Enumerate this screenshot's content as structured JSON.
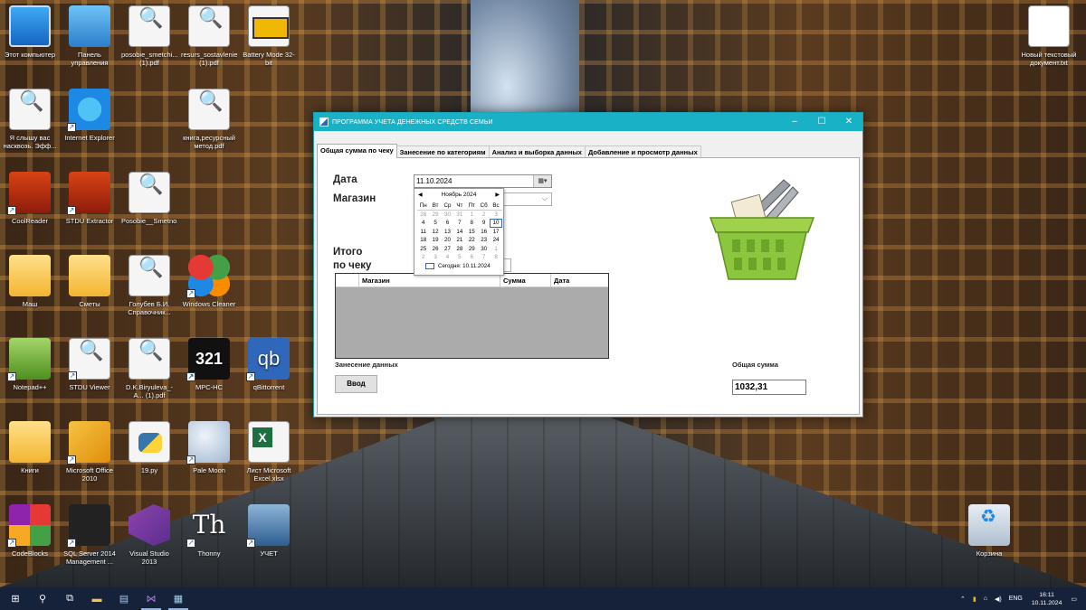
{
  "desktop": {
    "icons": [
      {
        "label": "Этот компьютер",
        "icon": "computer-icon"
      },
      {
        "label": "Панель управления",
        "icon": "control-panel-icon"
      },
      {
        "label": "posobie_smetchi... (1).pdf",
        "icon": "pdf-file-icon"
      },
      {
        "label": "resurs_sostavlenie (1).pdf",
        "icon": "pdf-file-icon"
      },
      {
        "label": "Battery Mode 32-bit",
        "icon": "battery-icon"
      },
      {
        "label": "Я слышу вас насквозь. Эфф...",
        "icon": "pdf-file-icon"
      },
      {
        "label": "Internet Explorer",
        "icon": "internet-explorer-icon"
      },
      {
        "label": "книга,ресурсный метод.pdf",
        "icon": "pdf-file-icon"
      },
      {
        "label": "CoolReader",
        "icon": "coolreader-icon"
      },
      {
        "label": "STDU Extractor",
        "icon": "stdu-extractor-icon"
      },
      {
        "label": "Posobie__Smetno...",
        "icon": "pdf-file-icon"
      },
      {
        "label": "Маш",
        "icon": "folder-icon"
      },
      {
        "label": "Сметы",
        "icon": "folder-icon"
      },
      {
        "label": "Голубев Б.И. Справочник...",
        "icon": "pdf-file-icon"
      },
      {
        "label": "Windows Cleaner",
        "icon": "windows-cleaner-icon"
      },
      {
        "label": "Notepad++",
        "icon": "notepad-plus-plus-icon"
      },
      {
        "label": "STDU Viewer",
        "icon": "stdu-viewer-icon"
      },
      {
        "label": "D.K.Biryuleva_-A... (1).pdf",
        "icon": "pdf-file-icon"
      },
      {
        "label": "MPC-HC",
        "icon": "mpc-hc-icon"
      },
      {
        "label": "qBittorrent",
        "icon": "qbittorrent-icon"
      },
      {
        "label": "Книги",
        "icon": "folder-icon"
      },
      {
        "label": "Microsoft Office 2010",
        "icon": "microsoft-office-icon"
      },
      {
        "label": "19.py",
        "icon": "python-file-icon"
      },
      {
        "label": "Pale Moon",
        "icon": "pale-moon-icon"
      },
      {
        "label": "Лист Microsoft Excel.xlsx",
        "icon": "excel-file-icon"
      },
      {
        "label": "CodeBlocks",
        "icon": "codeblocks-icon"
      },
      {
        "label": "SQL Server 2014 Management ...",
        "icon": "sql-server-icon"
      },
      {
        "label": "Visual Studio 2013",
        "icon": "visual-studio-icon"
      },
      {
        "label": "Thonny",
        "icon": "thonny-icon"
      },
      {
        "label": "УЧЕТ",
        "icon": "app-shortcut-icon"
      },
      {
        "label": "Новый текстовый документ.txt",
        "icon": "text-file-icon"
      },
      {
        "label": "Корзина",
        "icon": "recycle-bin-icon"
      }
    ]
  },
  "window": {
    "title": "ПРОГРАММА УЧЕТА ДЕНЕЖНЫХ СРЕДСТВ СЕМЬИ",
    "controls": {
      "minimize": "–",
      "maximize": "☐",
      "close": "✕"
    },
    "tabs": [
      {
        "label": "Общая сумма по чеку",
        "active": true
      },
      {
        "label": "Занесение по категориям",
        "active": false
      },
      {
        "label": "Анализ и выборка данных",
        "active": false
      },
      {
        "label": "Добавление и просмотр данных",
        "active": false
      }
    ],
    "form": {
      "date_label": "Дата",
      "date_value": "11.10.2024",
      "shop_label": "Магазин",
      "total_label_line1": "Итого",
      "total_label_line2": "по чеку",
      "entry_label": "Занесение данных",
      "enter_button": "Ввод",
      "sum_label": "Общая сумма",
      "sum_value": "1032,31"
    },
    "grid": {
      "columns": [
        "",
        "Магазин",
        "Сумма",
        "Дата"
      ]
    },
    "calendar": {
      "month": "Ноябрь 2024",
      "days_of_week": [
        "Пн",
        "Вт",
        "Ср",
        "Чт",
        "Пт",
        "Сб",
        "Вс"
      ],
      "weeks": [
        [
          {
            "d": "28",
            "o": true
          },
          {
            "d": "29",
            "o": true
          },
          {
            "d": "30",
            "o": true
          },
          {
            "d": "31",
            "o": true
          },
          {
            "d": "1",
            "o": true
          },
          {
            "d": "2",
            "o": true
          },
          {
            "d": "3",
            "o": true
          }
        ],
        [
          {
            "d": "4"
          },
          {
            "d": "5"
          },
          {
            "d": "6"
          },
          {
            "d": "7"
          },
          {
            "d": "8"
          },
          {
            "d": "9"
          },
          {
            "d": "10",
            "today": true
          }
        ],
        [
          {
            "d": "11"
          },
          {
            "d": "12"
          },
          {
            "d": "13"
          },
          {
            "d": "14"
          },
          {
            "d": "15"
          },
          {
            "d": "16"
          },
          {
            "d": "17"
          }
        ],
        [
          {
            "d": "18"
          },
          {
            "d": "19"
          },
          {
            "d": "20"
          },
          {
            "d": "21"
          },
          {
            "d": "22"
          },
          {
            "d": "23"
          },
          {
            "d": "24"
          }
        ],
        [
          {
            "d": "25"
          },
          {
            "d": "26"
          },
          {
            "d": "27"
          },
          {
            "d": "28"
          },
          {
            "d": "29"
          },
          {
            "d": "30"
          },
          {
            "d": "1",
            "o": true
          }
        ],
        [
          {
            "d": "2",
            "o": true
          },
          {
            "d": "3",
            "o": true
          },
          {
            "d": "4",
            "o": true
          },
          {
            "d": "5",
            "o": true
          },
          {
            "d": "6",
            "o": true
          },
          {
            "d": "7",
            "o": true
          },
          {
            "d": "8",
            "o": true
          }
        ]
      ],
      "today_text": "Сегодня: 10.11.2024"
    }
  },
  "taskbar": {
    "apps": [
      "windows-start-icon",
      "search-icon",
      "task-view-icon",
      "file-explorer-icon",
      "notepad-icon",
      "visual-studio-icon",
      "accounting-app-icon"
    ],
    "tray": {
      "language": "ENG",
      "time": "16:11",
      "date": "10.11.2024"
    }
  },
  "colors": {
    "title_bar": "#18b1c6",
    "taskbar": "#16213a",
    "basket_green": "#8cc63f"
  }
}
